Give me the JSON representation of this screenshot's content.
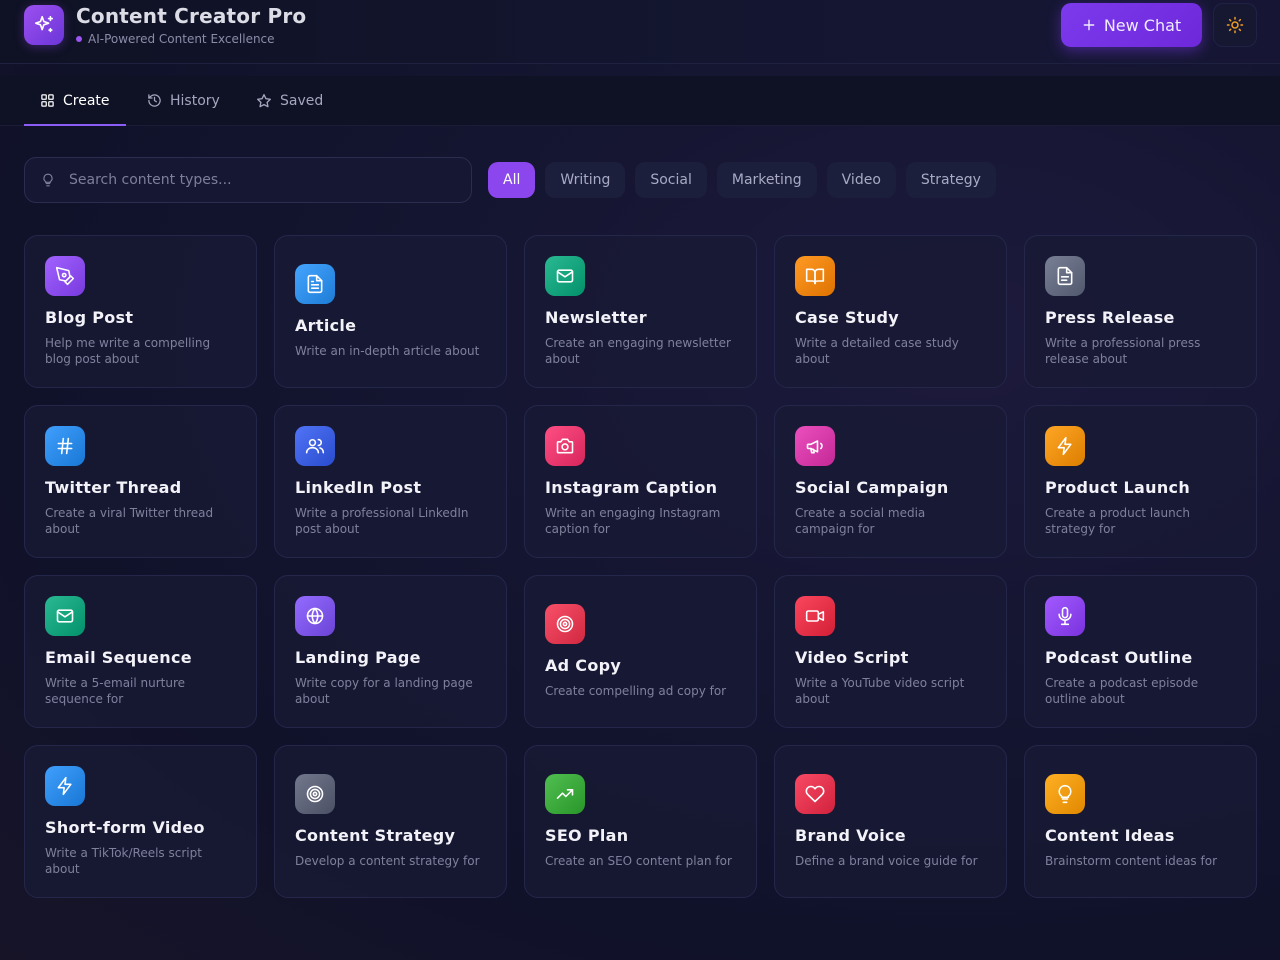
{
  "header": {
    "title": "Content Creator Pro",
    "subtitle": "AI-Powered Content Excellence",
    "new_chat_label": "New Chat",
    "logo_icon": "sparkles-icon",
    "theme_icon": "sun-icon",
    "accent": "#8b5cf6"
  },
  "tabs": [
    {
      "label": "Create",
      "icon": "grid-icon",
      "active": true
    },
    {
      "label": "History",
      "icon": "history-icon",
      "active": false
    },
    {
      "label": "Saved",
      "icon": "star-icon",
      "active": false
    }
  ],
  "search": {
    "placeholder": "Search content types..."
  },
  "filters": [
    "All",
    "Writing",
    "Social",
    "Marketing",
    "Video",
    "Strategy"
  ],
  "active_filter": "All",
  "cards": [
    {
      "title": "Blog Post",
      "desc": "Help me write a compelling blog post about",
      "icon": "pen-tool-icon",
      "color": "#8b4cf0"
    },
    {
      "title": "Article",
      "desc": "Write an in-depth article about",
      "icon": "file-text-icon",
      "color": "#2f8ee8"
    },
    {
      "title": "Newsletter",
      "desc": "Create an engaging newsletter about",
      "icon": "mail-icon",
      "color": "#14a37c"
    },
    {
      "title": "Case Study",
      "desc": "Write a detailed case study about",
      "icon": "book-open-icon",
      "color": "#f0840f"
    },
    {
      "title": "Press Release",
      "desc": "Write a professional press release about",
      "icon": "file-icon",
      "color": "#636a80"
    },
    {
      "title": "Twitter Thread",
      "desc": "Create a viral Twitter thread about",
      "icon": "hash-icon",
      "color": "#2a89e6"
    },
    {
      "title": "LinkedIn Post",
      "desc": "Write a professional LinkedIn post about",
      "icon": "users-icon",
      "color": "#3b5ddf"
    },
    {
      "title": "Instagram Caption",
      "desc": "Write an engaging Instagram caption for",
      "icon": "camera-icon",
      "color": "#e8386e"
    },
    {
      "title": "Social Campaign",
      "desc": "Create a social media campaign for",
      "icon": "megaphone-icon",
      "color": "#d53aa8"
    },
    {
      "title": "Product Launch",
      "desc": "Create a product launch strategy for",
      "icon": "zap-icon",
      "color": "#ee9010"
    },
    {
      "title": "Email Sequence",
      "desc": "Write a 5-email nurture sequence for",
      "icon": "mail-icon",
      "color": "#14a37c"
    },
    {
      "title": "Landing Page",
      "desc": "Write copy for a landing page about",
      "icon": "globe-icon",
      "color": "#7d55e8"
    },
    {
      "title": "Ad Copy",
      "desc": "Create compelling ad copy for",
      "icon": "target-icon",
      "color": "#e33a53"
    },
    {
      "title": "Video Script",
      "desc": "Write a YouTube video script about",
      "icon": "video-icon",
      "color": "#e53148"
    },
    {
      "title": "Podcast Outline",
      "desc": "Create a podcast episode outline about",
      "icon": "mic-icon",
      "color": "#8c44ef"
    },
    {
      "title": "Short-form Video",
      "desc": "Write a TikTok/Reels script about",
      "icon": "zap-icon",
      "color": "#2a89e6"
    },
    {
      "title": "Content Strategy",
      "desc": "Develop a content strategy for",
      "icon": "target-icon",
      "color": "#5d6277"
    },
    {
      "title": "SEO Plan",
      "desc": "Create an SEO content plan for",
      "icon": "trending-up-icon",
      "color": "#3aa83a"
    },
    {
      "title": "Brand Voice",
      "desc": "Define a brand voice guide for",
      "icon": "heart-icon",
      "color": "#e3344f"
    },
    {
      "title": "Content Ideas",
      "desc": "Brainstorm content ideas for",
      "icon": "lightbulb-icon",
      "color": "#f39a0e"
    }
  ]
}
